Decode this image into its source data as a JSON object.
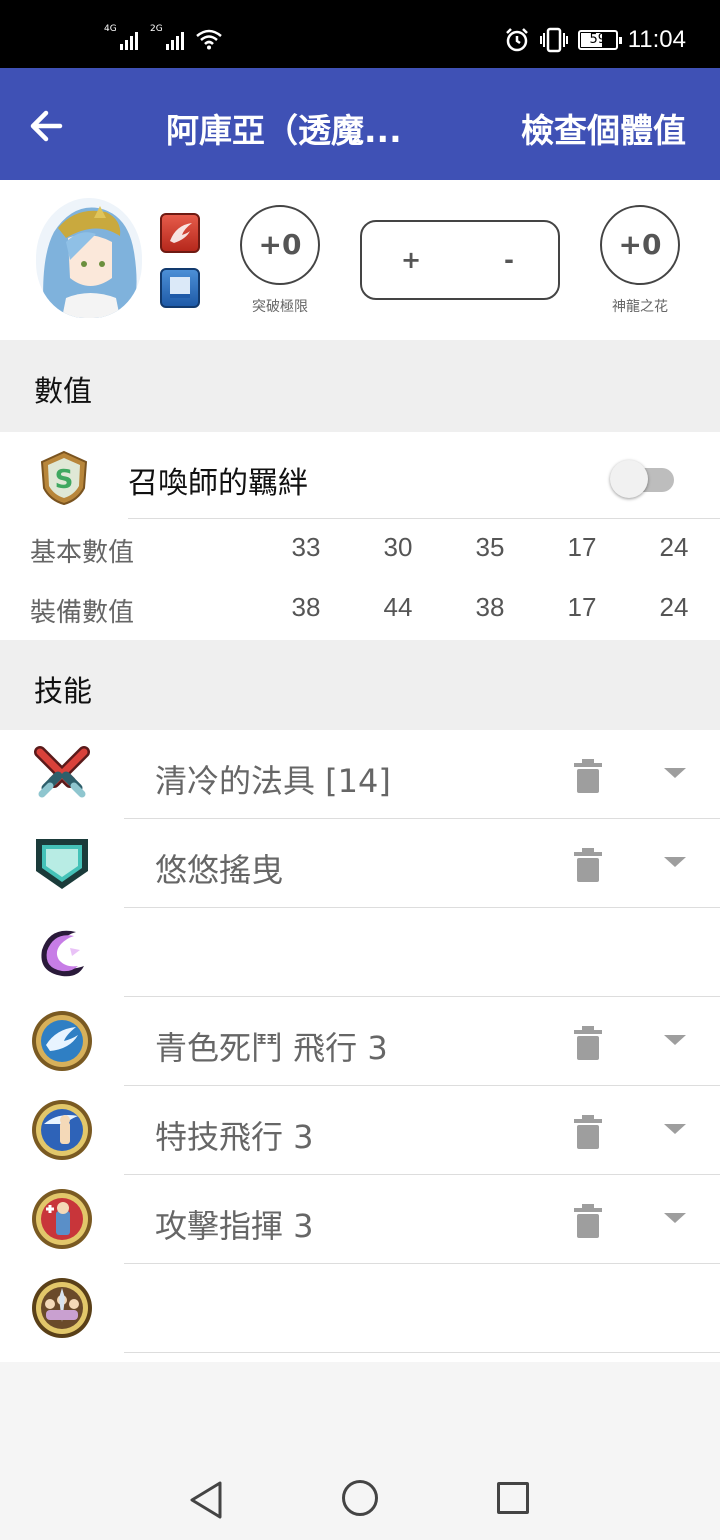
{
  "status_bar": {
    "network_1": "4G",
    "network_2": "2G",
    "battery_level": "59",
    "time": "11:04"
  },
  "app_bar": {
    "title": "阿庫亞（透魔...",
    "action_label": "檢查個體值"
  },
  "hero": {
    "merge_value": "+0",
    "merge_caption": "突破極限",
    "stepper_plus": "+",
    "stepper_minus": "-",
    "flower_value": "+0",
    "flower_caption": "神龍之花"
  },
  "stats_section": {
    "header": "數值",
    "summoner_bond_label": "召喚師的羈絆",
    "summoner_bond_enabled": false,
    "rows": [
      {
        "label": "基本數值",
        "values": [
          "33",
          "30",
          "35",
          "17",
          "24"
        ]
      },
      {
        "label": "裝備數值",
        "values": [
          "38",
          "44",
          "38",
          "17",
          "24"
        ]
      }
    ]
  },
  "skills_section": {
    "header": "技能",
    "skills": [
      {
        "icon": "weapon-icon",
        "name": "清冷的法具  [14]",
        "has_actions": true
      },
      {
        "icon": "assist-icon",
        "name": "悠悠搖曳",
        "has_actions": true
      },
      {
        "icon": "special-icon",
        "name": "",
        "has_actions": false
      },
      {
        "icon": "passive-a-icon",
        "name": "青色死鬥 飛行 3",
        "has_actions": true
      },
      {
        "icon": "passive-b-icon",
        "name": "特技飛行 3",
        "has_actions": true
      },
      {
        "icon": "passive-c-icon",
        "name": "攻擊指揮 3",
        "has_actions": true
      },
      {
        "icon": "sacred-seal-icon",
        "name": "",
        "has_actions": false
      }
    ]
  },
  "colors": {
    "app_bar": "#3f51b5",
    "section_background": "#efefef"
  }
}
